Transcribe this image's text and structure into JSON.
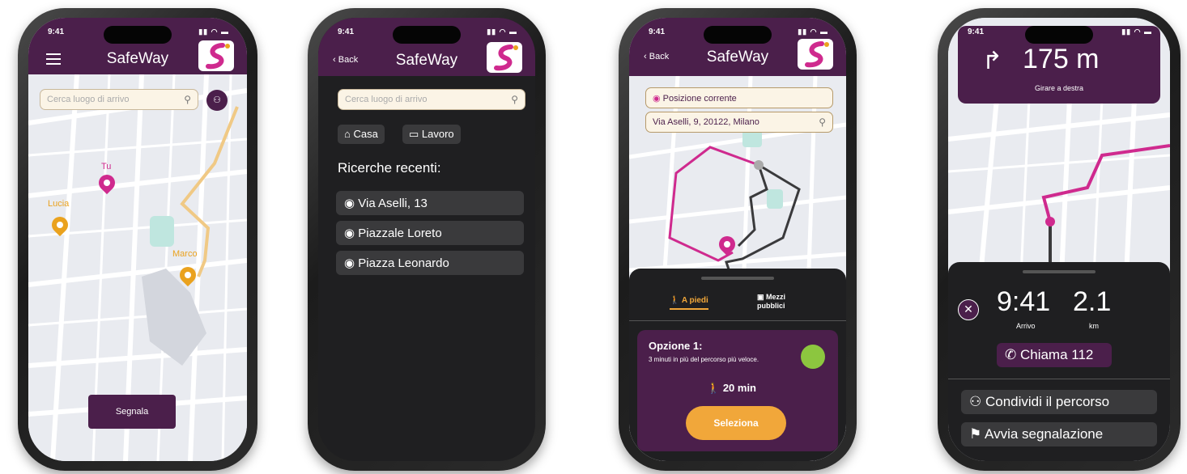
{
  "common": {
    "time": "9:41",
    "app_name": "SafeWay",
    "back_label": "Back"
  },
  "screen1": {
    "search_placeholder": "Cerca luogo di arrivo",
    "pins": {
      "tu": "Tu",
      "lucia": "Lucia",
      "marco": "Marco"
    },
    "report_button": "Segnala"
  },
  "screen2": {
    "search_placeholder": "Cerca luogo di arrivo",
    "chips": [
      "Casa",
      "Lavoro"
    ],
    "recent_title": "Ricerche recenti:",
    "recent": [
      "Via Aselli, 13",
      "Piazzale Loreto",
      "Piazza Leonardo"
    ]
  },
  "screen3": {
    "origin": "Posizione corrente",
    "destination": "Via Aselli, 9, 20122, Milano",
    "modes": {
      "walk": "A piedi",
      "transit": "Mezzi pubblici"
    },
    "option": {
      "title": "Opzione 1:",
      "desc": "3 minuti in più del percorso più veloce.",
      "duration": "20 min",
      "select": "Seleziona"
    }
  },
  "screen4": {
    "distance": "175 m",
    "instruction": "Girare a destra",
    "arrival_time": "9:41",
    "arrival_label": "Arrivo",
    "km": "2.1",
    "km_label": "km",
    "call": "Chiama 112",
    "share": "Condividi il percorso",
    "report": "Avvia segnalazione"
  },
  "colors": {
    "brand": "#4b1f4b",
    "accent": "#cf2a8e",
    "orange": "#eaa21e",
    "green": "#8cc63f"
  }
}
